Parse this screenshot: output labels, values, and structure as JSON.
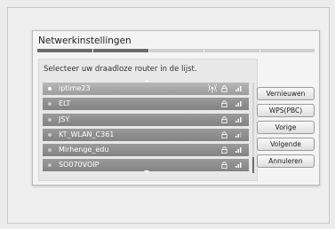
{
  "dialog": {
    "title": "Netwerkinstellingen",
    "instruction": "Selecteer uw draadloze router in de lijst.",
    "progress_fraction": 0.4,
    "progress_segments": 5
  },
  "networks": [
    {
      "name": "iptime23",
      "selected": true,
      "icons": [
        "wps-icon",
        "lock-icon",
        "signal-icon"
      ]
    },
    {
      "name": "ELT",
      "icons": [
        "lock-icon",
        "signal-icon"
      ]
    },
    {
      "name": "JSY",
      "icons": [
        "lock-icon",
        "signal-icon"
      ]
    },
    {
      "name": "KT_WLAN_C361",
      "icons": [
        "lock-icon",
        "signal-icon"
      ]
    },
    {
      "name": "Mirhenge_edu",
      "icons": [
        "lock-icon",
        "signal-icon"
      ]
    },
    {
      "name": "SO070VOIP",
      "icons": [
        "lock-icon",
        "signal-icon"
      ]
    }
  ],
  "buttons": {
    "refresh": "Vernieuwen",
    "wps": "WPS(PBC)",
    "previous": "Vorige",
    "next": "Volgende",
    "cancel": "Annuleren"
  },
  "colors": {
    "row": "#8e8e8e",
    "row_selected": "#aaaaaa",
    "progress_fill": "#6a6a6a"
  }
}
